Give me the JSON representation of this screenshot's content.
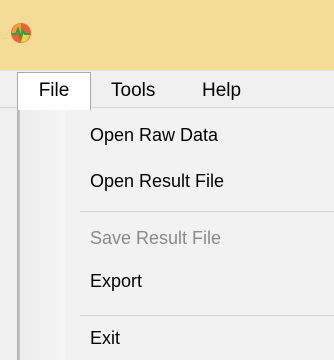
{
  "menubar": {
    "items": [
      {
        "label": "File"
      },
      {
        "label": "Tools"
      },
      {
        "label": "Help"
      }
    ]
  },
  "file_menu": {
    "items": [
      {
        "label": "Open Raw Data",
        "enabled": true
      },
      {
        "label": "Open Result File",
        "enabled": true
      },
      {
        "label": "Save Result File",
        "enabled": false
      },
      {
        "label": "Export",
        "enabled": true
      },
      {
        "label": "Exit",
        "enabled": true
      }
    ]
  },
  "colors": {
    "titlebar": "#f5dc96",
    "menubar": "#f0f0f0",
    "disabled_text": "#8a8a8a"
  },
  "icons": {
    "app": "heart-pulse-app-icon"
  }
}
